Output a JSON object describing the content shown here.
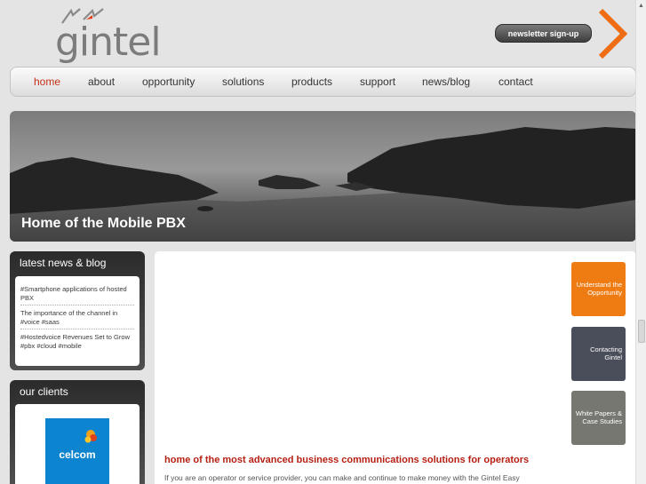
{
  "header": {
    "logo_text": "gintel",
    "newsletter_label": "newsletter sign-up"
  },
  "nav": {
    "items": [
      {
        "label": "home",
        "active": true
      },
      {
        "label": "about"
      },
      {
        "label": "opportunity"
      },
      {
        "label": "solutions"
      },
      {
        "label": "products"
      },
      {
        "label": "support"
      },
      {
        "label": "news/blog"
      },
      {
        "label": "contact"
      }
    ]
  },
  "hero": {
    "title": "Home of the Mobile PBX"
  },
  "news_panel": {
    "title": "latest news & blog",
    "items": [
      {
        "text": "#Smartphone applications of hosted PBX"
      },
      {
        "text": "The importance of the channel in #voice #saas"
      },
      {
        "text": "#Hostedvoice Revenues Set to Grow #pbx #cloud #mobile"
      }
    ]
  },
  "clients_panel": {
    "title": "our clients",
    "client_name": "celcom"
  },
  "tiles": [
    {
      "label": "Understand the Opportunity"
    },
    {
      "label": "Contacting Gintel"
    },
    {
      "label": "White Papers & Case Studies"
    }
  ],
  "content": {
    "headline": "home of the most advanced business communications solutions for operators",
    "intro": "If you are an operator or service provider, you can make and continue to make money with the Gintel Easy"
  },
  "colors": {
    "accent_red": "#c3311a",
    "orange": "#ee7c13",
    "dark_tile": "#4a4e5a",
    "grey_tile": "#767770",
    "client_blue": "#0d84cf"
  }
}
